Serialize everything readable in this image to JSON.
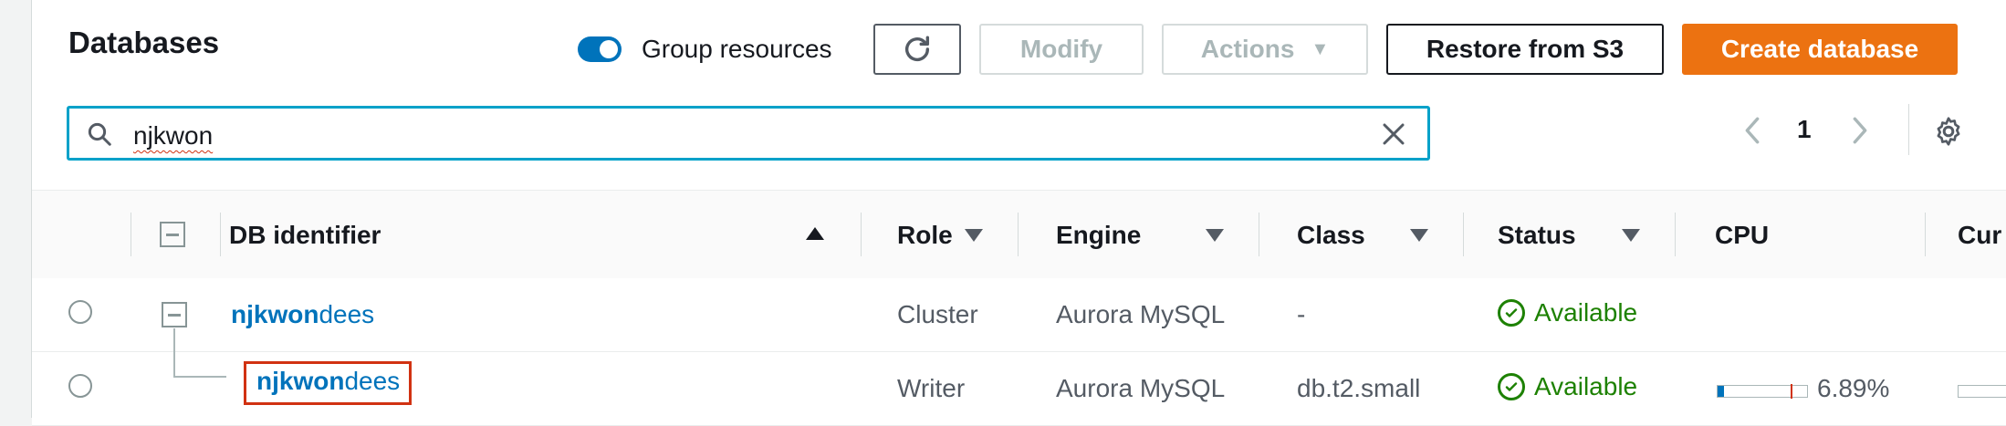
{
  "header": {
    "title": "Databases",
    "group_resources_label": "Group resources",
    "group_resources_on": true
  },
  "toolbar": {
    "modify_label": "Modify",
    "actions_label": "Actions",
    "restore_label": "Restore from S3",
    "create_label": "Create database"
  },
  "search": {
    "value": "njkwon"
  },
  "pagination": {
    "current_page": "1"
  },
  "table": {
    "columns": [
      "DB identifier",
      "Role",
      "Engine",
      "Class",
      "Status",
      "CPU",
      "Cur"
    ],
    "rows": [
      {
        "id_prefix": "njkwon",
        "id_suffix": "dees",
        "role": "Cluster",
        "engine": "Aurora MySQL",
        "class": "-",
        "status": "Available",
        "cpu": ""
      },
      {
        "id_prefix": "njkwon",
        "id_suffix": "dees",
        "role": "Writer",
        "engine": "Aurora MySQL",
        "class": "db.t2.small",
        "status": "Available",
        "cpu": "6.89%",
        "cpu_fraction": 0.0689
      }
    ]
  },
  "colors": {
    "accent": "#0073bb",
    "primary_button": "#ec7211",
    "status_ok": "#1d8102",
    "highlight": "#d13212",
    "search_border": "#00a1c9"
  },
  "icons": [
    "search-icon",
    "clear-icon",
    "refresh-icon",
    "chevron-left-icon",
    "chevron-right-icon",
    "settings-gear-icon",
    "sort-ascending-icon",
    "filter-caret-icon",
    "status-available-icon",
    "collapse-icon"
  ]
}
